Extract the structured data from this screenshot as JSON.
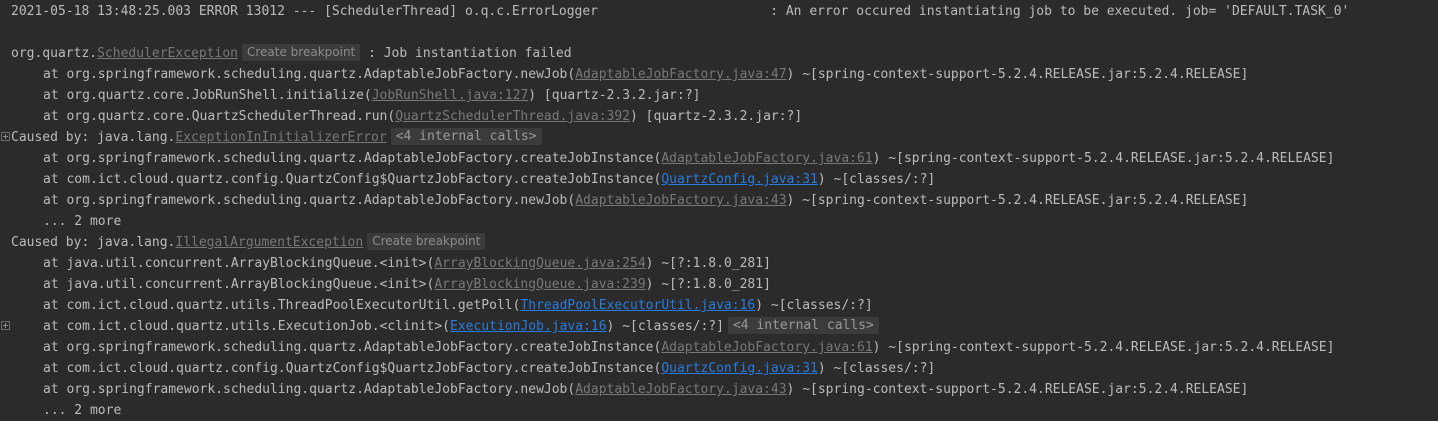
{
  "log": {
    "header": {
      "prefix": "2021-05-18 13:48:25.003 ERROR 13012 --- [SchedulerThread] o.q.c.ErrorLogger",
      "padding": "                      ",
      "message": ": An error occured instantiating job to be executed. job= 'DEFAULT.TASK_0'"
    },
    "exception": {
      "package": "org.quartz.",
      "class_link": "SchedulerException",
      "breakpoint": "Create breakpoint",
      "message": " : Job instantiation failed",
      "frames": [
        {
          "prefix": "at org.springframework.scheduling.quartz.AdaptableJobFactory.newJob(",
          "link": "AdaptableJobFactory.java:47",
          "suffix": ") ~[spring-context-support-5.2.4.RELEASE.jar:5.2.4.RELEASE]"
        },
        {
          "prefix": "at org.quartz.core.JobRunShell.initialize(",
          "link": "JobRunShell.java:127",
          "suffix": ") [quartz-2.3.2.jar:?]"
        },
        {
          "prefix": "at org.quartz.core.QuartzSchedulerThread.run(",
          "link": "QuartzSchedulerThread.java:392",
          "suffix": ") [quartz-2.3.2.jar:?]"
        }
      ]
    },
    "cause1": {
      "prefix": "Caused by: java.lang.",
      "class_link": "ExceptionInInitializerError",
      "internal": "<4 internal calls>",
      "frames": [
        {
          "prefix": "at org.springframework.scheduling.quartz.AdaptableJobFactory.createJobInstance(",
          "link": "AdaptableJobFactory.java:61",
          "suffix": ") ~[spring-context-support-5.2.4.RELEASE.jar:5.2.4.RELEASE]"
        },
        {
          "prefix": "at com.ict.cloud.quartz.config.QuartzConfig$QuartzJobFactory.createJobInstance(",
          "link": "QuartzConfig.java:31",
          "suffix": ") ~[classes/:?]"
        },
        {
          "prefix": "at org.springframework.scheduling.quartz.AdaptableJobFactory.newJob(",
          "link": "AdaptableJobFactory.java:43",
          "suffix": ") ~[spring-context-support-5.2.4.RELEASE.jar:5.2.4.RELEASE]"
        }
      ],
      "more": "... 2 more"
    },
    "cause2": {
      "prefix": "Caused by: java.lang.",
      "class_link": "IllegalArgumentException",
      "breakpoint": "Create breakpoint",
      "frames": [
        {
          "prefix": "at java.util.concurrent.ArrayBlockingQueue.<init>(",
          "link": "ArrayBlockingQueue.java:254",
          "suffix": ") ~[?:1.8.0_281]"
        },
        {
          "prefix": "at java.util.concurrent.ArrayBlockingQueue.<init>(",
          "link": "ArrayBlockingQueue.java:239",
          "suffix": ") ~[?:1.8.0_281]"
        },
        {
          "prefix": "at com.ict.cloud.quartz.utils.ThreadPoolExecutorUtil.getPoll(",
          "link": "ThreadPoolExecutorUtil.java:16",
          "suffix": ") ~[classes/:?]"
        },
        {
          "prefix": "at com.ict.cloud.quartz.utils.ExecutionJob.<clinit>(",
          "link": "ExecutionJob.java:16",
          "suffix": ") ~[classes/:?]",
          "internal": "<4 internal calls>"
        },
        {
          "prefix": "at org.springframework.scheduling.quartz.AdaptableJobFactory.createJobInstance(",
          "link": "AdaptableJobFactory.java:61",
          "suffix": ") ~[spring-context-support-5.2.4.RELEASE.jar:5.2.4.RELEASE]"
        },
        {
          "prefix": "at com.ict.cloud.quartz.config.QuartzConfig$QuartzJobFactory.createJobInstance(",
          "link": "QuartzConfig.java:31",
          "suffix": ") ~[classes/:?]"
        },
        {
          "prefix": "at org.springframework.scheduling.quartz.AdaptableJobFactory.newJob(",
          "link": "AdaptableJobFactory.java:43",
          "suffix": ") ~[spring-context-support-5.2.4.RELEASE.jar:5.2.4.RELEASE]"
        }
      ],
      "more": "... 2 more"
    }
  },
  "icons": {
    "fold": "fold-expand-icon"
  },
  "colors": {
    "background": "#2b2b2b",
    "text": "#bbbbbb",
    "library_link": "#787878",
    "project_link": "#287bde",
    "hint_background": "#3b3b3b"
  }
}
